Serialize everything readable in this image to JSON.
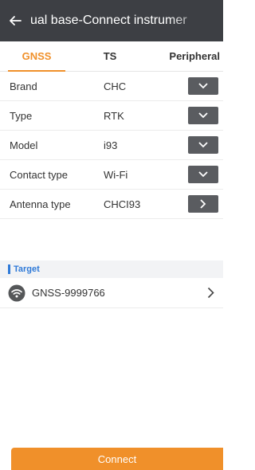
{
  "header": {
    "back_icon": "arrow-left-icon",
    "title": "ual base-Connect instrumer"
  },
  "tabs": [
    {
      "label": "GNSS",
      "active": true
    },
    {
      "label": "TS",
      "active": false
    },
    {
      "label": "Peripheral",
      "active": false
    }
  ],
  "form": {
    "brand": {
      "label": "Brand",
      "value": "CHC",
      "control": "dropdown"
    },
    "type": {
      "label": "Type",
      "value": "RTK",
      "control": "dropdown"
    },
    "model": {
      "label": "Model",
      "value": "i93",
      "control": "dropdown"
    },
    "contact_type": {
      "label": "Contact type",
      "value": "Wi-Fi",
      "control": "dropdown"
    },
    "antenna_type": {
      "label": "Antenna type",
      "value": "CHCI93",
      "control": "navigate"
    }
  },
  "target": {
    "label": "Target",
    "device": {
      "name": "GNSS-9999766",
      "icon": "wifi-icon"
    }
  },
  "footer": {
    "connect_label": "Connect"
  },
  "colors": {
    "accent": "#f0902a",
    "header_bg": "#3d3f44",
    "target_blue": "#2f7ad8",
    "dropdown_btn": "#5a5c60"
  }
}
